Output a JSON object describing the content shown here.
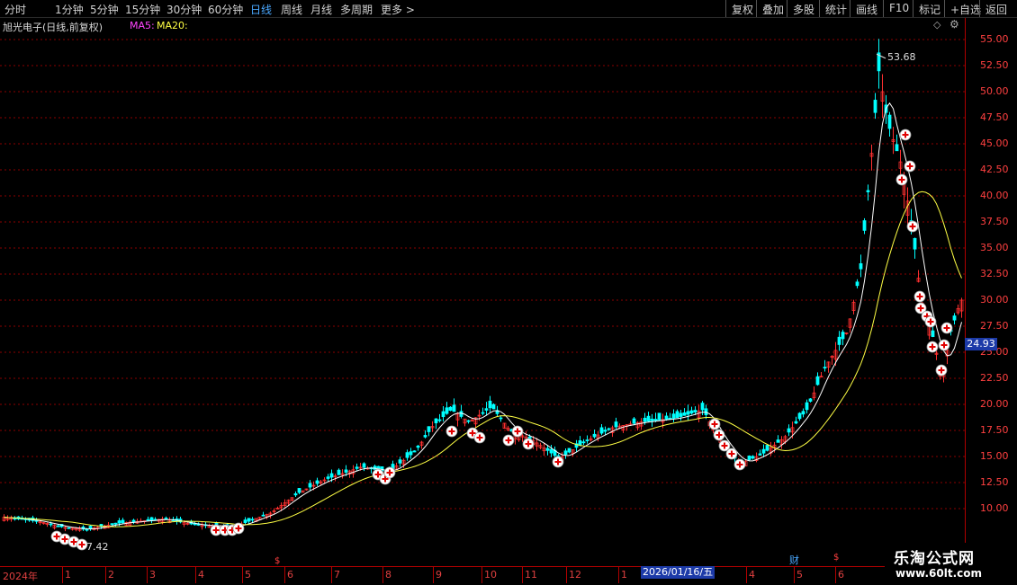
{
  "toolbar": {
    "periods": [
      "分时",
      "1分钟",
      "5分钟",
      "15分钟",
      "30分钟",
      "60分钟",
      "日线",
      "周线",
      "月线",
      "多周期",
      "更多 >"
    ],
    "active": "日线",
    "right_buttons": [
      "复权",
      "叠加",
      "多股",
      "统计",
      "画线",
      "F10",
      "标记",
      "+自选",
      "返回"
    ]
  },
  "info": {
    "stock_title": "旭光电子(日线,前复权)",
    "ma5_label": "MA5:",
    "ma20_label": "MA20:"
  },
  "price_axis": {
    "labels": [
      "55.00",
      "52.50",
      "50.00",
      "47.50",
      "45.00",
      "42.50",
      "40.00",
      "37.50",
      "35.00",
      "32.50",
      "30.00",
      "27.50",
      "25.00",
      "22.50",
      "20.00",
      "17.50",
      "15.00",
      "12.50",
      "10.00"
    ],
    "last_price": "24.93"
  },
  "chart_annotations": {
    "high_label": "53.68",
    "low_label": "7.42"
  },
  "time_axis": {
    "labels": [
      "2024年",
      "1",
      "2",
      "3",
      "4",
      "5",
      "6",
      "7",
      "8",
      "9",
      "10",
      "11",
      "12",
      "1",
      "4",
      "5",
      "6"
    ],
    "cursor_date": "2026/01/16/五",
    "markers": [
      "$",
      "财",
      "$"
    ]
  },
  "watermark": {
    "line1": "乐淘公式网",
    "line2": "www.60lt.com"
  },
  "colors": {
    "background": "#000000",
    "grid": "#8b0000",
    "up": "#ff3030",
    "down": "#00ffff",
    "ma5": "#ffffff",
    "ma20": "#ffff44",
    "signal": "#ffffff"
  }
}
